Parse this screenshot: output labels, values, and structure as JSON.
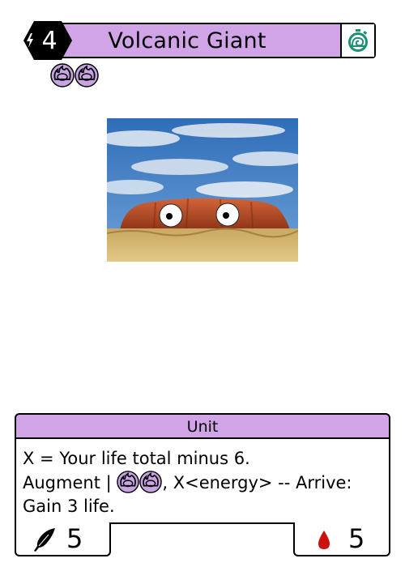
{
  "card": {
    "cost": "4",
    "name": "Volcanic Giant",
    "speed_icon": "snail-stopwatch-icon",
    "threshold_icons": [
      "ember-orb-icon",
      "ember-orb-icon"
    ],
    "type": "Unit",
    "text": {
      "line1": "X = Your life total minus 6.",
      "line2_prefix": "Augment |",
      "line2_suffix": ", X<energy> -- Arrive:",
      "line3": "Gain 3 life."
    },
    "stats": {
      "power": "5",
      "health": "5",
      "power_icon": "quill-icon",
      "health_icon": "blood-drop-icon"
    }
  },
  "colors": {
    "title_bar": "#d0a4e6",
    "cost_hex": "#000000",
    "speed_icon": "#1d8f74",
    "orb": "#c9a4e2",
    "blood": "#cc1010"
  }
}
